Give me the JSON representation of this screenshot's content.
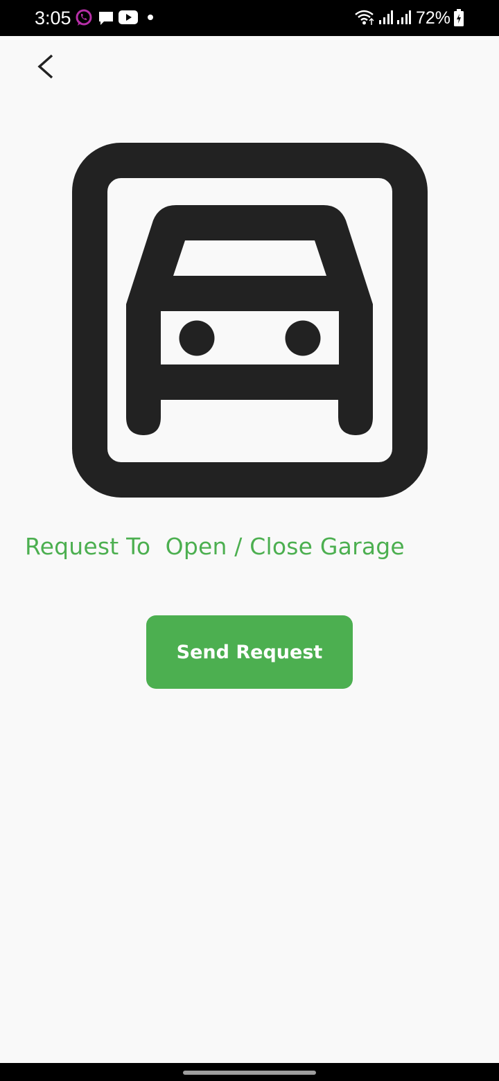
{
  "status_bar": {
    "time": "3:05",
    "battery_percent": "72%",
    "notification_icons": [
      "whatsapp-icon",
      "message-icon",
      "youtube-icon",
      "dot-icon"
    ],
    "system_icons": [
      "wifi-icon",
      "signal-icon",
      "signal-icon",
      "battery-charging-icon"
    ]
  },
  "toolbar": {
    "back_icon": "chevron-left-icon"
  },
  "hero": {
    "icon": "garage-car-icon"
  },
  "main": {
    "title": "Request To  Open / Close Garage",
    "send_button_label": "Send Request"
  },
  "colors": {
    "accent": "#4caf50",
    "icon": "#222222",
    "background": "#f9f9f9",
    "whatsapp": "#b72fa8"
  }
}
